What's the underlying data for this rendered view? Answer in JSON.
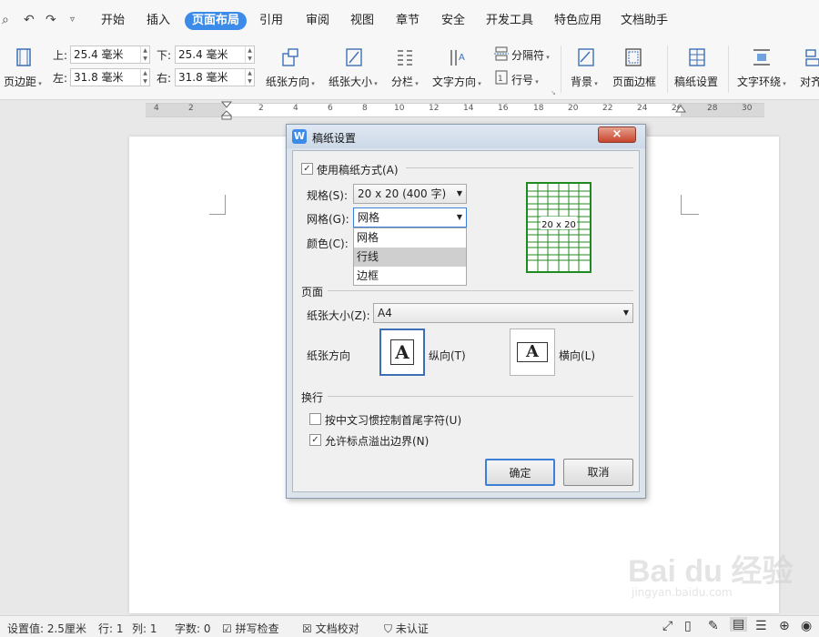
{
  "tabs": [
    "开始",
    "插入",
    "页面布局",
    "引用",
    "审阅",
    "视图",
    "章节",
    "安全",
    "开发工具",
    "特色应用",
    "文档助手"
  ],
  "ribbon": {
    "margin_button": "页边距",
    "top_label": "上:",
    "top_value": "25.4 毫米",
    "bottom_label": "下:",
    "bottom_value": "25.4 毫米",
    "left_label": "左:",
    "left_value": "31.8 毫米",
    "right_label": "右:",
    "right_value": "31.8 毫米",
    "orientation": "纸张方向",
    "paper_size": "纸张大小",
    "columns": "分栏",
    "text_direction": "文字方向",
    "separator": "分隔符",
    "line_number": "行号",
    "background": "背景",
    "page_border": "页面边框",
    "manuscript": "稿纸设置",
    "text_wrap": "文字环绕",
    "align": "对齐"
  },
  "ruler_ticks": [
    "4",
    "2",
    "2",
    "4",
    "6",
    "8",
    "10",
    "12",
    "14",
    "16",
    "18",
    "20",
    "22",
    "24",
    "26",
    "28",
    "30"
  ],
  "dialog": {
    "title": "稿纸设置",
    "use_manuscript": "使用稿纸方式(A)",
    "spec_label": "规格(S):",
    "spec_value": "20 x 20 (400 字)",
    "grid_label": "网格(G):",
    "grid_value": "网格",
    "color_label": "颜色(C):",
    "grid_options": [
      "网格",
      "行线",
      "边框"
    ],
    "preview_text": "20 x 20",
    "page_section": "页面",
    "paper_size_label": "纸张大小(Z):",
    "paper_size_value": "A4",
    "orientation_label": "纸张方向",
    "portrait": "纵向(T)",
    "landscape": "横向(L)",
    "orientation_glyph": "A",
    "wrap_section": "换行",
    "chinese_rule": "按中文习惯控制首尾字符(U)",
    "allow_punct": "允许标点溢出边界(N)",
    "ok": "确定",
    "cancel": "取消",
    "close_glyph": "×"
  },
  "status": {
    "setting": "设置值: 2.5厘米",
    "row": "行: 1",
    "col": "列: 1",
    "chars": "字数: 0",
    "spell": "拼写检查",
    "proof": "文档校对",
    "cert": "未认证"
  },
  "watermark": {
    "brand": "Bai du 经验",
    "url": "jingyan.baidu.com"
  },
  "colors": {
    "accent": "#3d8be8",
    "preview_green": "#1f8a1f",
    "selected_option": "#cfcfcf"
  }
}
